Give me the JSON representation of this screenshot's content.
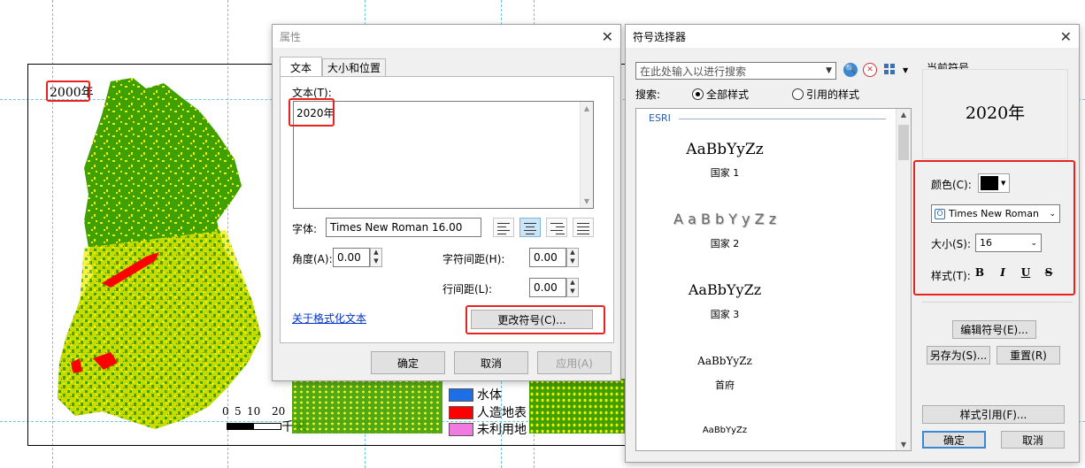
{
  "map": {
    "year_label": "2000年",
    "scale_numbers": [
      "0",
      "5",
      "10",
      "20"
    ],
    "scale_unit": "千米",
    "legend": [
      {
        "label": "水体",
        "color": "#1e6fe6"
      },
      {
        "label": "人造地表",
        "color": "#ff0000"
      },
      {
        "label": "未利用地",
        "color": "#f07ae0"
      }
    ]
  },
  "properties_dialog": {
    "title": "属性",
    "tabs": [
      {
        "label": "文本"
      },
      {
        "label": "大小和位置"
      }
    ],
    "text_label": "文本(T):",
    "text_value": "2020年",
    "font_label": "字体:",
    "font_value": "Times New Roman 16.00",
    "angle_label": "角度(A):",
    "angle_value": "0.00",
    "char_spacing_label": "字符间距(H):",
    "char_spacing_value": "0.00",
    "line_spacing_label": "行间距(L):",
    "line_spacing_value": "0.00",
    "format_link": "关于格式化文本",
    "change_symbol_button": "更改符号(C)...",
    "ok_button": "确定",
    "cancel_button": "取消",
    "apply_button": "应用(A)"
  },
  "symbol_selector": {
    "title": "符号选择器",
    "search_placeholder": "在此处输入以进行搜索",
    "search_label": "搜索:",
    "radio_all": "全部样式",
    "radio_referenced": "引用的样式",
    "group_label": "ESRI",
    "items": [
      {
        "sample": "AaBbYyZz",
        "name": "国家 1"
      },
      {
        "sample": "A a B b Y y Z z",
        "name": "国家 2"
      },
      {
        "sample": "AaBbYyZz",
        "name": "国家 3"
      },
      {
        "sample": "AaBbYyZz",
        "name": "首府"
      },
      {
        "sample": "AaBbYyZz",
        "name": ""
      }
    ],
    "current_symbol_label": "当前符号",
    "preview_text": "2020年",
    "color_label": "颜色(C):",
    "color_value": "#000000",
    "font_value": "Times New Roman",
    "size_label": "大小(S):",
    "size_value": "16",
    "style_label": "样式(T):",
    "style_buttons": [
      "B",
      "I",
      "U",
      "S"
    ],
    "edit_symbol_button": "编辑符号(E)...",
    "save_as_button": "另存为(S)...",
    "reset_button": "重置(R)",
    "style_references_button": "样式引用(F)...",
    "ok_button": "确定",
    "cancel_button": "取消"
  },
  "colors": {
    "highlight_red": "#e8231f",
    "map_green": "#3fa000",
    "map_yellow": "#f2ee00",
    "link_blue": "#0033cc"
  }
}
